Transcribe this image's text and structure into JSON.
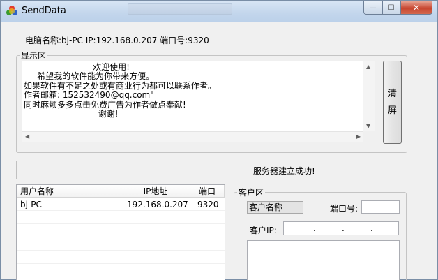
{
  "window": {
    "title": "SendData",
    "minimize_glyph": "—",
    "maximize_glyph": "☐",
    "close_glyph": "✕"
  },
  "info": {
    "text": "电脑名称:bj-PC  IP:192.168.0.207  端口号:9320"
  },
  "display": {
    "legend": "显示区",
    "text": "                          欢迎使用!\n     希望我的软件能为你带来方便。\n如果软件有不足之处或有商业行为都可以联系作者。\n作者邮箱: 152532490@qq.com\"\n同时麻烦多多点击免费广告为作者做点奉献!\n                            谢谢!",
    "clear_button_line1": "清",
    "clear_button_line2": "屏"
  },
  "status": {
    "message": "服务器建立成功!"
  },
  "user_table": {
    "columns": [
      "用户名称",
      "IP地址",
      "端口"
    ],
    "rows": [
      [
        "bj-PC",
        "192.168.0.207",
        "9320"
      ]
    ]
  },
  "client": {
    "legend": "客户区",
    "name_value": "客户名称",
    "port_label": "端口号:",
    "ip_label": "客户IP:",
    "ip_separator": "."
  },
  "colors": {
    "title_bar": "#c3d6ec",
    "close_button": "#c7452f",
    "window_bg": "#f0f0f0"
  }
}
